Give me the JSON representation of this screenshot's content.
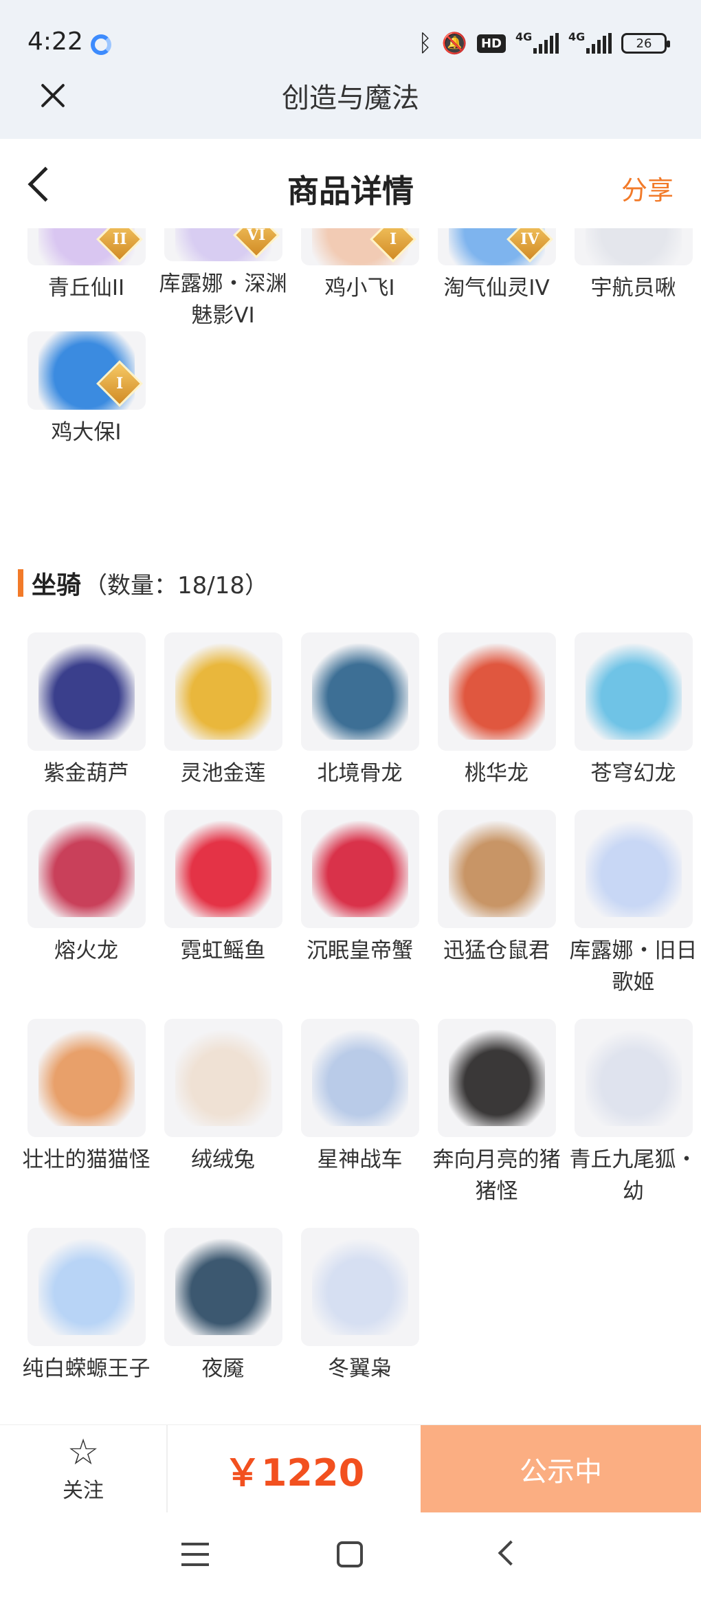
{
  "status_bar": {
    "time": "4:22",
    "hd": "HD",
    "network": "4G",
    "network2": "4G",
    "battery": "26"
  },
  "app_bar": {
    "title": "创造与魔法"
  },
  "header": {
    "title": "商品详情",
    "share": "分享"
  },
  "partial_items": [
    {
      "name": "青丘仙II",
      "badge": "II",
      "color": "#d9c6f1"
    },
    {
      "name": "库露娜・深渊魅影VI",
      "badge": "VI",
      "color": "#d8cdf2"
    },
    {
      "name": "鸡小飞I",
      "badge": "I",
      "color": "#f2cbb4"
    },
    {
      "name": "淘气仙灵IV",
      "badge": "IV",
      "color": "#7eb4ee"
    },
    {
      "name": "宇航员啾",
      "badge": "",
      "color": "#e4e6ec"
    },
    {
      "name": "鸡大保I",
      "badge": "I",
      "color": "#3b8be0"
    }
  ],
  "mount_section": {
    "title": "坐骑",
    "count": "（数量：18/18）"
  },
  "mounts": [
    {
      "name": "紫金葫芦",
      "color": "#3a3f8c"
    },
    {
      "name": "灵池金莲",
      "color": "#e9b73c"
    },
    {
      "name": "北境骨龙",
      "color": "#3d6f95"
    },
    {
      "name": "桃华龙",
      "color": "#e0573f"
    },
    {
      "name": "苍穹幻龙",
      "color": "#6fc3e6"
    },
    {
      "name": "熔火龙",
      "color": "#c9405a"
    },
    {
      "name": "霓虹鳐鱼",
      "color": "#e43346"
    },
    {
      "name": "沉眠皇帝蟹",
      "color": "#d9324a"
    },
    {
      "name": "迅猛仓鼠君",
      "color": "#c89566"
    },
    {
      "name": "库露娜・旧日歌姬",
      "color": "#c8d7f5"
    },
    {
      "name": "壮壮的猫猫怪",
      "color": "#e8a06a"
    },
    {
      "name": "绒绒兔",
      "color": "#efe1d4"
    },
    {
      "name": "星神战车",
      "color": "#b9cbe8"
    },
    {
      "name": "奔向月亮的猪猪怪",
      "color": "#3a3838"
    },
    {
      "name": "青丘九尾狐・幼",
      "color": "#dfe3ee"
    },
    {
      "name": "纯白蝾螈王子",
      "color": "#b8d4f6"
    },
    {
      "name": "夜魇",
      "color": "#3c5870"
    },
    {
      "name": "冬翼枭",
      "color": "#d6dff2"
    }
  ],
  "action_bar": {
    "follow": "关注",
    "price": "￥1220",
    "cta": "公示中"
  },
  "icons": {
    "close": "close-icon",
    "back": "back-icon",
    "star": "star-icon",
    "menu": "menu-icon",
    "home": "home-icon",
    "nav_back": "nav-back-icon"
  },
  "colors": {
    "accent": "#f27a29",
    "price": "#f2501f",
    "cta_bg": "#fbae82"
  }
}
